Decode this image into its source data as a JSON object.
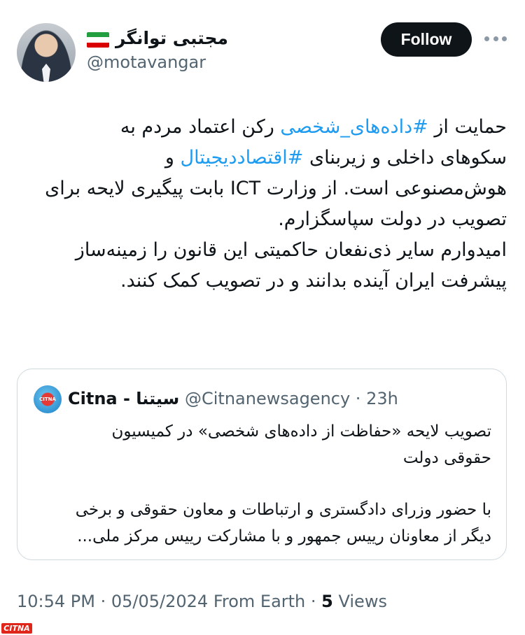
{
  "author": {
    "display_name": "مجتبی توانگر",
    "handle": "@motavangar",
    "flag_colors": [
      "#239f40",
      "#ffffff",
      "#da0000"
    ]
  },
  "follow_label": "Follow",
  "tweet": {
    "lines": [
      {
        "parts": [
          {
            "t": "حمایت از "
          },
          {
            "t": "#داده‌های_شخصی",
            "hl": true
          },
          {
            "t": " رکن اعتماد مردم به"
          }
        ]
      },
      {
        "parts": [
          {
            "t": "سکوهای داخلی و زیربنای "
          },
          {
            "t": "#اقتصاددیجیتال",
            "hl": true
          },
          {
            "t": " و"
          }
        ]
      },
      {
        "parts": [
          {
            "t": "هوش‌مصنوعی است. از وزارت ICT بابت پیگیری لایحه برای"
          }
        ]
      },
      {
        "parts": [
          {
            "t": "تصویب در دولت سپاسگزارم."
          }
        ]
      },
      {
        "parts": [
          {
            "t": "امیدوارم سایر ذی‌نفعان حاکمیتی این قانون را زمینه‌ساز"
          }
        ]
      },
      {
        "parts": [
          {
            "t": "پیشرفت ایران آینده بدانند و در تصویب کمک کنند."
          }
        ]
      }
    ]
  },
  "quote": {
    "name": "Citna - سیتنا",
    "handle_time": "@Citnanewsagency · 23h",
    "logo_text": "CITNA",
    "lines": [
      "تصویب لایحه «حفاظت از داده‌های شخصی» در کمیسیون",
      "حقوقی دولت",
      "",
      "با حضور وزرای دادگستری و ارتباطات و معاون حقوقی و برخی",
      "دیگر از معاونان رییس جمهور و با مشارکت رییس مرکز ملی..."
    ]
  },
  "meta": {
    "time_date_source": "10:54 PM · 05/05/2024 From Earth · ",
    "views_count": "5",
    "views_label": " Views"
  },
  "watermark": "CITNA",
  "colors": {
    "accent": "#1d9bf0",
    "text": "#0f1419",
    "secondary": "#536471",
    "border": "#cfd9de"
  }
}
